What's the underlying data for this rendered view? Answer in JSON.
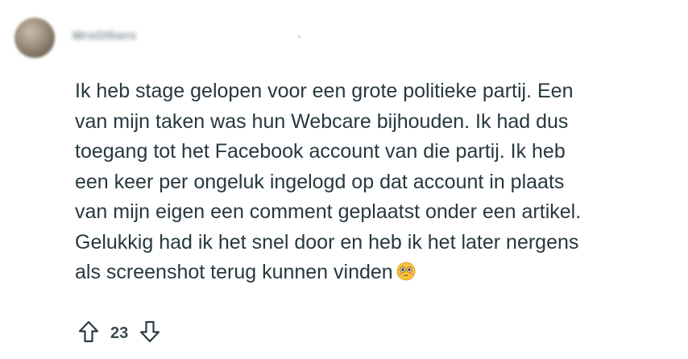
{
  "comment": {
    "author": "MrsOthers",
    "body_lines": [
      "Ik heb stage gelopen voor een grote politieke partij. Een",
      "van mijn taken was hun Webcare bijhouden. Ik had dus",
      "toegang tot het Facebook account van die partij. Ik heb",
      "een keer per ongeluk ingelogd op dat account in plaats",
      "van mijn eigen een comment geplaatst onder een artikel.",
      "Gelukkig had ik het snel door en heb ik het later nergens",
      "als screenshot terug kunnen vinden"
    ],
    "emoji": "flushed-face-emoji",
    "score": "23"
  },
  "icons": {
    "upvote": "arrow-up-icon",
    "downvote": "arrow-down-icon"
  },
  "colors": {
    "text": "#27383f",
    "icon": "#2a3c42",
    "emoji_face": "#f7c33a"
  }
}
